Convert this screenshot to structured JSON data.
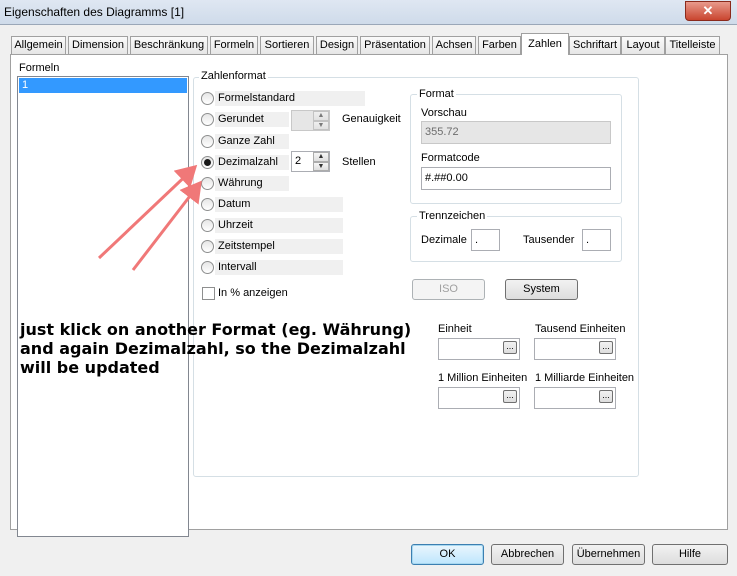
{
  "window": {
    "title": "Eigenschaften des Diagramms [1]",
    "close_glyph": "✕"
  },
  "tabs": [
    {
      "label": "Allgemein"
    },
    {
      "label": "Dimension"
    },
    {
      "label": "Beschränkung"
    },
    {
      "label": "Formeln"
    },
    {
      "label": "Sortieren"
    },
    {
      "label": "Design"
    },
    {
      "label": "Präsentation"
    },
    {
      "label": "Achsen"
    },
    {
      "label": "Farben"
    },
    {
      "label": "Zahlen",
      "active": true
    },
    {
      "label": "Schriftart"
    },
    {
      "label": "Layout"
    },
    {
      "label": "Titelleiste"
    }
  ],
  "formeln": {
    "label": "Formeln",
    "items": [
      "1"
    ]
  },
  "zahlenformat": {
    "title": "Zahlenformat",
    "options": [
      {
        "label": "Formelstandard",
        "checked": false
      },
      {
        "label": "Gerundet",
        "checked": false
      },
      {
        "label": "Ganze Zahl",
        "checked": false
      },
      {
        "label": "Dezimalzahl",
        "checked": true
      },
      {
        "label": "Währung",
        "checked": false
      },
      {
        "label": "Datum",
        "checked": false
      },
      {
        "label": "Uhrzeit",
        "checked": false
      },
      {
        "label": "Zeitstempel",
        "checked": false
      },
      {
        "label": "Intervall",
        "checked": false
      }
    ],
    "genauigkeit_label": "Genauigkeit",
    "genauigkeit_value": "",
    "stellen_label": "Stellen",
    "stellen_value": "2",
    "percent_label": "In % anzeigen",
    "percent_checked": false
  },
  "format": {
    "title": "Format",
    "vorschau_label": "Vorschau",
    "vorschau_value": "355.72",
    "formatcode_label": "Formatcode",
    "formatcode_value": "#.##0.00"
  },
  "trennzeichen": {
    "title": "Trennzeichen",
    "dezimale_label": "Dezimale",
    "dezimale_value": ".",
    "tausender_label": "Tausender",
    "tausender_value": "."
  },
  "buttons_mid": {
    "iso": "ISO",
    "system": "System"
  },
  "einheiten": {
    "einheit": "Einheit",
    "tausend": "Tausend Einheiten",
    "million": "1 Million Einheiten",
    "milliarde": "1 Milliarde Einheiten",
    "browse": "..."
  },
  "annotation": {
    "text_lines": [
      "just klick on another Format (eg. Währung)",
      "and again Dezimalzahl, so the Dezimalzahl",
      "will be updated"
    ],
    "arrow_color": "#f07878"
  },
  "footer": {
    "ok": "OK",
    "abbrechen": "Abbrechen",
    "uebernehmen": "Übernehmen",
    "hilfe": "Hilfe"
  }
}
